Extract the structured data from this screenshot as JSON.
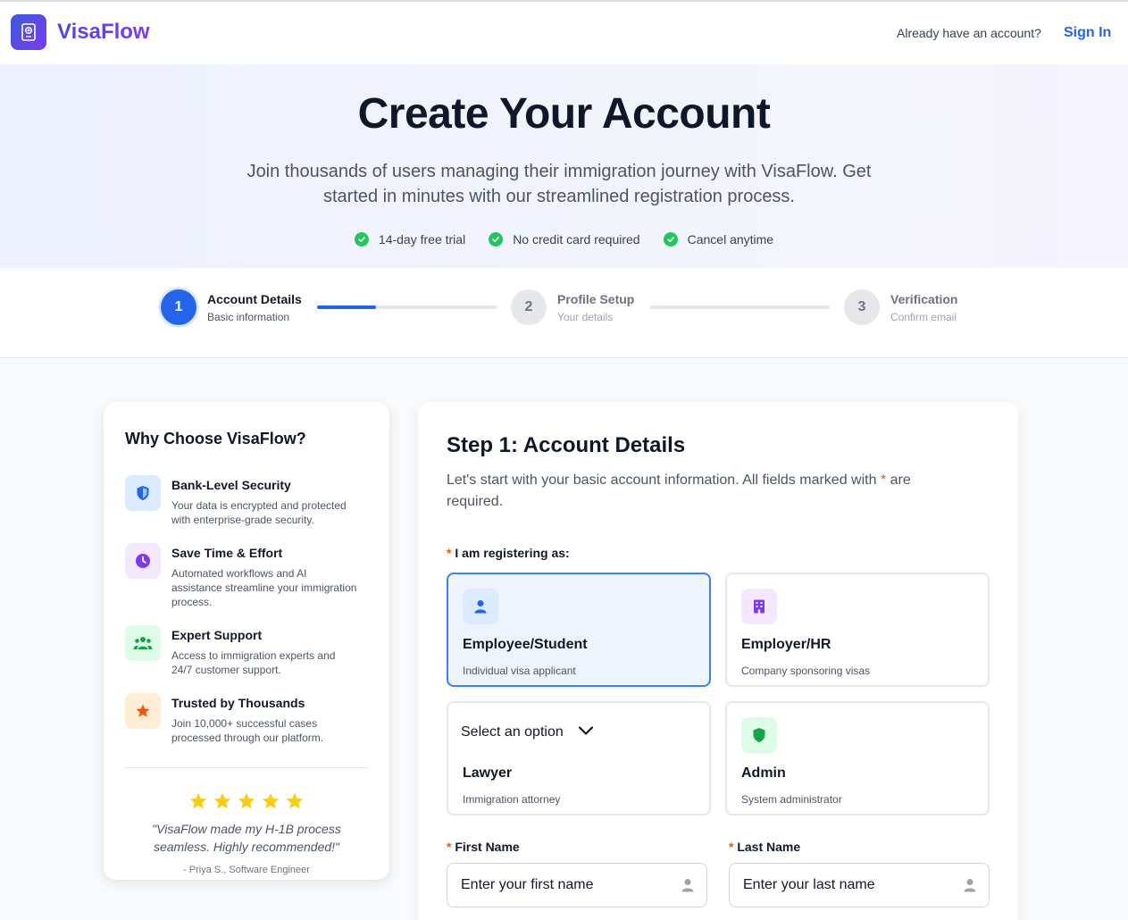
{
  "header": {
    "brand": "VisaFlow",
    "already_text": "Already have an account?",
    "signin_label": "Sign In"
  },
  "hero": {
    "title": "Create Your Account",
    "subtitle": "Join thousands of users managing their immigration journey with VisaFlow. Get started in minutes with our streamlined registration process.",
    "perks": [
      "14-day free trial",
      "No credit card required",
      "Cancel anytime"
    ]
  },
  "stepper": {
    "progress_fraction": 0.33,
    "steps": [
      {
        "number": "1",
        "title": "Account Details",
        "subtitle": "Basic information",
        "status": "active"
      },
      {
        "number": "2",
        "title": "Profile Setup",
        "subtitle": "Your details",
        "status": "pending"
      },
      {
        "number": "3",
        "title": "Verification",
        "subtitle": "Confirm email",
        "status": "pending"
      }
    ]
  },
  "why": {
    "title": "Why Choose VisaFlow?",
    "features": [
      {
        "title": "Bank-Level Security",
        "desc": "Your data is encrypted and protected with enterprise-grade security.",
        "icon": "shield-icon",
        "color": "#2563eb",
        "bg": "#dbeafe"
      },
      {
        "title": "Save Time & Effort",
        "desc": "Automated workflows and AI assistance streamline your immigration process.",
        "icon": "clock-icon",
        "color": "#7c3aed",
        "bg": "#f3e8ff"
      },
      {
        "title": "Expert Support",
        "desc": "Access to immigration experts and 24/7 customer support.",
        "icon": "users-icon",
        "color": "#16a34a",
        "bg": "#dcfce7"
      },
      {
        "title": "Trusted by Thousands",
        "desc": "Join 10,000+ successful cases processed through our platform.",
        "icon": "star-icon",
        "color": "#ea580c",
        "bg": "#ffedd5"
      }
    ],
    "rating": 5,
    "quote": "\"VisaFlow made my H-1B process seamless. Highly recommended!\"",
    "author": "- Priya S., Software Engineer"
  },
  "form": {
    "title": "Step 1: Account Details",
    "intro_before": "Let's start with your basic account information. All fields marked with",
    "required_mark": "*",
    "intro_after": "are required.",
    "role_label": "I am registering as:",
    "roles": [
      {
        "title": "Employee/Student",
        "subtitle": "Individual visa applicant",
        "icon": "user-icon",
        "selected": true
      },
      {
        "title": "Employer/HR",
        "subtitle": "Company sponsoring visas",
        "icon": "building-icon",
        "selected": false
      },
      {
        "title": "Lawyer",
        "subtitle": "Immigration attorney",
        "select_value": "Select an option",
        "icon": "chevron-down-icon",
        "selected": false
      },
      {
        "title": "Admin",
        "subtitle": "System administrator",
        "icon": "shield-icon",
        "selected": false
      }
    ],
    "first_name": {
      "label": "First Name",
      "placeholder": "Enter your first name"
    },
    "last_name": {
      "label": "Last Name",
      "placeholder": "Enter your last name"
    }
  },
  "colors": {
    "accent": "#2563eb",
    "required": "#ea580c",
    "success": "#22c55e",
    "star": "#facc15"
  }
}
